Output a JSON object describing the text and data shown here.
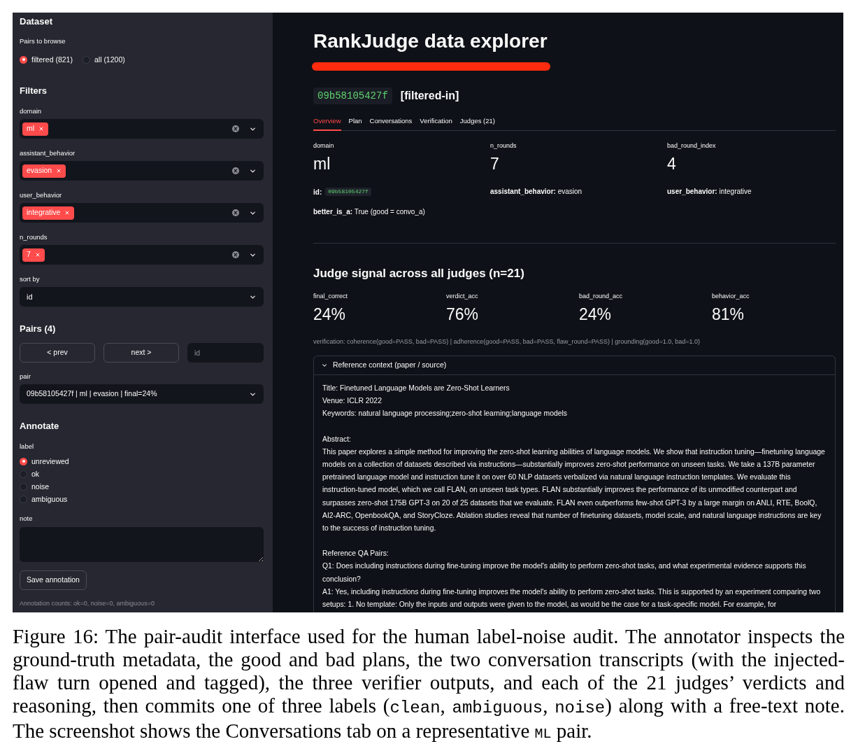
{
  "sidebar": {
    "dataset": {
      "heading": "Dataset",
      "label": "Pairs to browse",
      "options": [
        {
          "label": "filtered (821)",
          "selected": true
        },
        {
          "label": "all (1200)",
          "selected": false
        }
      ]
    },
    "filters": {
      "heading": "Filters",
      "multiselects": [
        {
          "label": "domain",
          "tags": [
            "ml"
          ]
        },
        {
          "label": "assistant_behavior",
          "tags": [
            "evasion"
          ]
        },
        {
          "label": "user_behavior",
          "tags": [
            "integrative"
          ]
        },
        {
          "label": "n_rounds",
          "tags": [
            "7"
          ]
        }
      ],
      "sort": {
        "label": "sort by",
        "value": "id"
      }
    },
    "pairs": {
      "heading": "Pairs (4)",
      "prev_button": "< prev",
      "next_button": "next >",
      "id_field": {
        "placeholder": "id"
      },
      "pair_select": {
        "label": "pair",
        "value": "09b58105427f | ml | evasion | final=24%"
      }
    },
    "annotate": {
      "heading": "Annotate",
      "label": "label",
      "options": [
        {
          "label": "unreviewed",
          "selected": true
        },
        {
          "label": "ok",
          "selected": false
        },
        {
          "label": "noise",
          "selected": false
        },
        {
          "label": "ambiguous",
          "selected": false
        }
      ],
      "note": {
        "label": "note"
      },
      "save_button": "Save annotation",
      "counts": "Annotation counts: ok=0, noise=0, ambiguous=0"
    }
  },
  "main": {
    "title": "RankJudge data explorer",
    "pair_id": "09b58105427f",
    "pair_status": "[filtered-in]",
    "tabs": [
      {
        "label": "Overview",
        "selected": true
      },
      {
        "label": "Plan",
        "selected": false
      },
      {
        "label": "Conversations",
        "selected": false
      },
      {
        "label": "Verification",
        "selected": false
      },
      {
        "label": "Judges (21)",
        "selected": false
      }
    ],
    "metrics": [
      {
        "label": "domain",
        "value": "ml"
      },
      {
        "label": "n_rounds",
        "value": "7"
      },
      {
        "label": "bad_round_index",
        "value": "4"
      }
    ],
    "field_rows": [
      [
        {
          "kind": "code",
          "label": "id:",
          "value": "09b58105427f"
        },
        {
          "kind": "text",
          "text": "**assistant_behavior:** evasion"
        },
        {
          "kind": "text",
          "text": "**user_behavior:** integrative"
        }
      ],
      [
        {
          "kind": "text",
          "text": "**better_is_a:** True (good = convo_a)"
        }
      ]
    ],
    "judge_signal": {
      "heading": "Judge signal across all judges (n=21)",
      "metrics": [
        {
          "label": "final_correct",
          "value": "24%"
        },
        {
          "label": "verdict_acc",
          "value": "76%"
        },
        {
          "label": "bad_round_acc",
          "value": "24%"
        },
        {
          "label": "behavior_acc",
          "value": "81%"
        }
      ],
      "verification": "verification: coherence(good=PASS, bad=PASS) | adherence(good=PASS, bad=PASS, flaw_round=PASS) | grounding(good=1.0, bad=1.0)"
    },
    "reference": {
      "title": "Reference context (paper / source)",
      "expanded": true,
      "sections": [
        [
          "Title: Finetuned Language Models are Zero-Shot Learners",
          "Venue: ICLR 2022",
          "Keywords: natural language processing;zero-shot learning;language models"
        ],
        [
          "Abstract:",
          "This paper explores a simple method for improving the zero-shot learning abilities of language models. We show that instruction tuning—finetuning language models on a collection of datasets described via instructions—substantially improves zero-shot performance on unseen tasks. We take a 137B parameter pretrained language model and instruction tune it on over 60 NLP datasets verbalized via natural language instruction templates. We evaluate this instruction-tuned model, which we call FLAN, on unseen task types. FLAN substantially improves the performance of its unmodified counterpart and surpasses zero-shot 175B GPT-3 on 20 of 25 datasets that we evaluate. FLAN even outperforms few-shot GPT-3 by a large margin on ANLI, RTE, BoolQ, AI2-ARC, OpenbookQA, and StoryCloze. Ablation studies reveal that number of finetuning datasets, model scale, and natural language instructions are key to the success of instruction tuning."
        ],
        [
          "Reference QA Pairs:",
          "Q1: Does including instructions during fine-tuning improve the model's ability to perform zero-shot tasks, and what experimental evidence supports this conclusion?",
          "A1: Yes, including instructions during fine-tuning improves the model's ability to perform zero-shot tasks. This is supported by an experiment comparing two setups: 1. No template: Only the inputs and outputs were given to the model, as would be the case for a task-specific model. For example, for"
        ]
      ]
    }
  },
  "caption": {
    "segments": [
      {
        "kind": "text",
        "text": "Figure 16: The pair-audit interface used for the human label-noise audit. The annotator inspects the ground-truth metadata, the good and bad plans, the two conversation transcripts (with the injected-flaw turn opened and tagged), the three verifier outputs, and each of the 21 judges’ verdicts and reasoning, then commits one of three labels ("
      },
      {
        "kind": "code",
        "text": "clean"
      },
      {
        "kind": "text",
        "text": ", "
      },
      {
        "kind": "code",
        "text": "ambiguous"
      },
      {
        "kind": "text",
        "text": ", "
      },
      {
        "kind": "code",
        "text": "noise"
      },
      {
        "kind": "text",
        "text": ") along with a free-text note. The screenshot shows the Conversations tab on a representative "
      },
      {
        "kind": "small",
        "text": "ML"
      },
      {
        "kind": "text",
        "text": " pair."
      }
    ]
  }
}
